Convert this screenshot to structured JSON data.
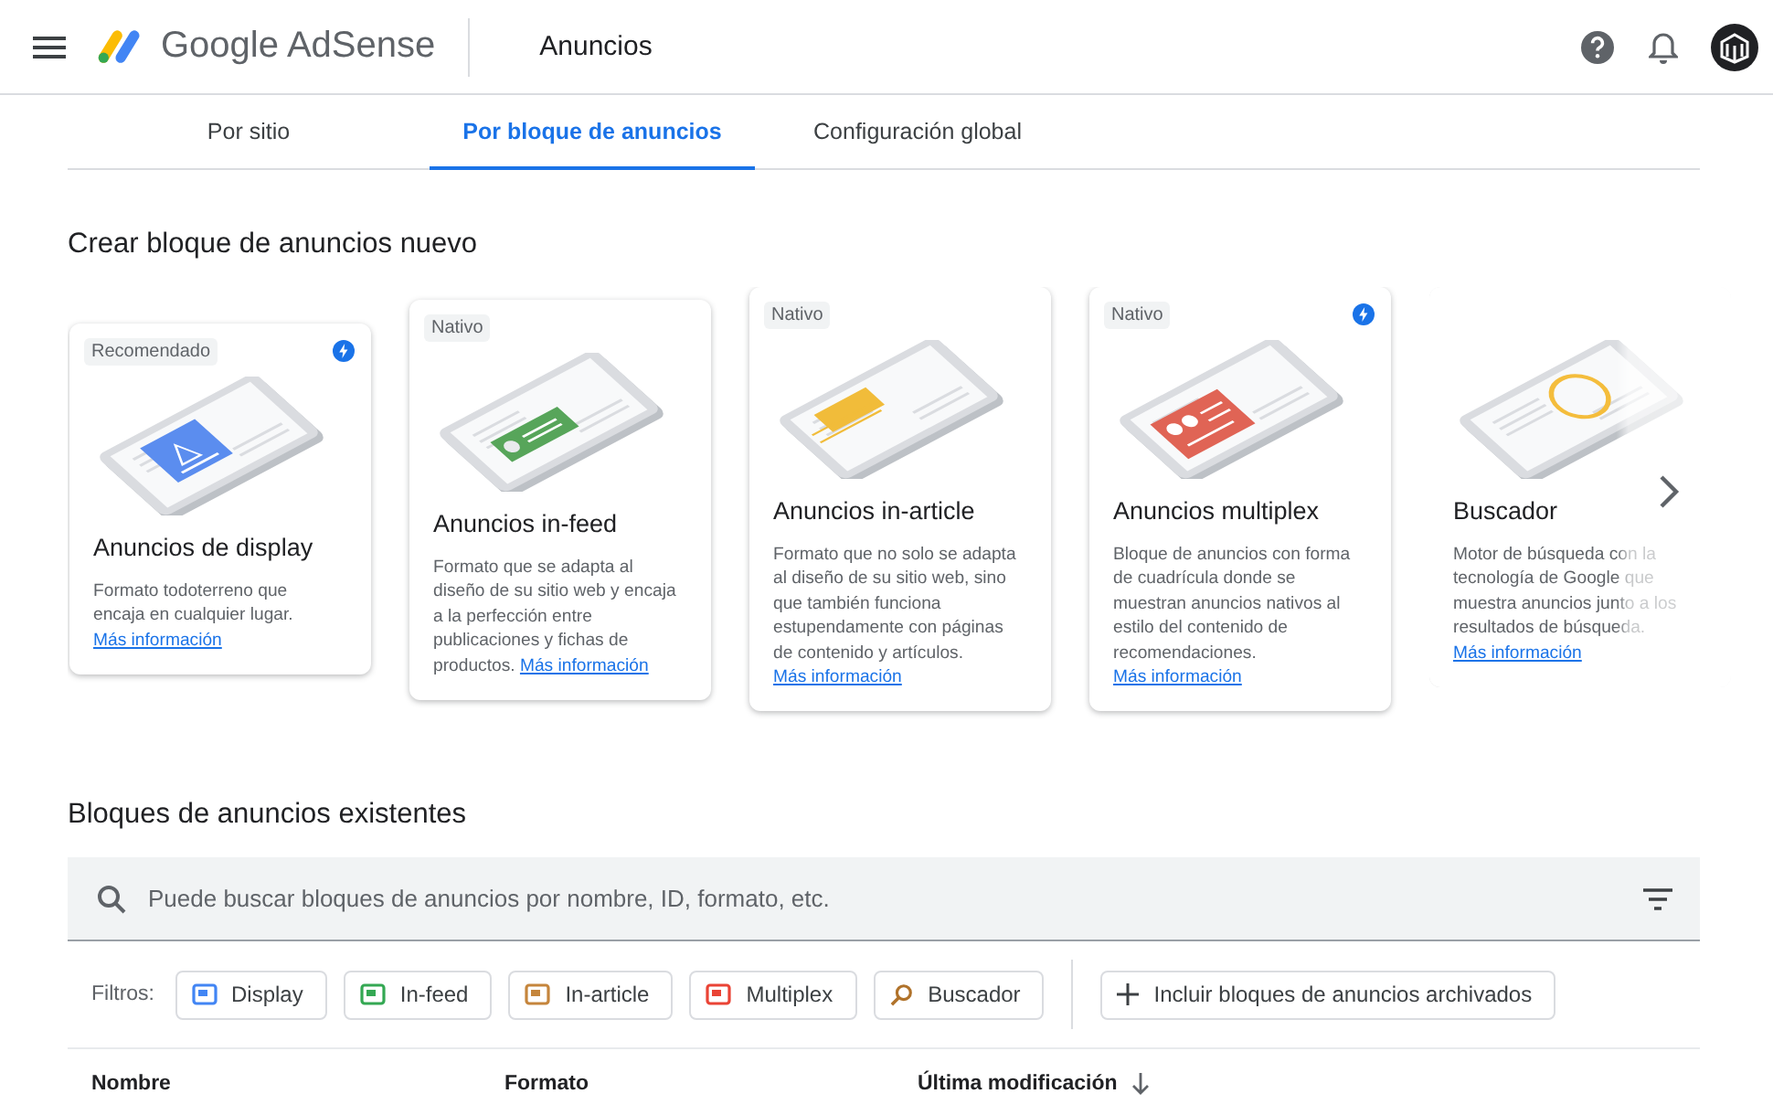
{
  "header": {
    "product": "Google AdSense",
    "page_title": "Anuncios"
  },
  "tabs": [
    {
      "label": "Por sitio",
      "selected": false
    },
    {
      "label": "Por bloque de anuncios",
      "selected": true
    },
    {
      "label": "Configuración global",
      "selected": false
    }
  ],
  "create_section": {
    "title": "Crear bloque de anuncios nuevo",
    "cards": [
      {
        "kind": "display",
        "badge": "Recomendado",
        "boosted": true,
        "color": "#5b8def",
        "title": "Anuncios de display",
        "description": "Formato todoterreno que encaja en cualquier lugar.",
        "link": "Más información"
      },
      {
        "kind": "infeed",
        "badge": "Nativo",
        "boosted": false,
        "color": "#57a55a",
        "title": "Anuncios in-feed",
        "description": "Formato que se adapta al diseño de su sitio web y encaja a la perfección entre publicaciones y fichas de productos.",
        "link": "Más información"
      },
      {
        "kind": "inarticle",
        "badge": "Nativo",
        "boosted": false,
        "color": "#f1bc3a",
        "title": "Anuncios in-article",
        "description": "Formato que no solo se adapta al diseño de su sitio web, sino que también funciona estupendamente con páginas de contenido y artículos.",
        "link": "Más información"
      },
      {
        "kind": "multiplex",
        "badge": "Nativo",
        "boosted": true,
        "color": "#e06455",
        "title": "Anuncios multiplex",
        "description": "Bloque de anuncios con forma de cuadrícula donde se muestran anuncios nativos al estilo del contenido de recomendaciones.",
        "link": "Más información"
      },
      {
        "kind": "search",
        "boosted": false,
        "color": "#f4bd3c",
        "title": "Buscador",
        "description": "Motor de búsqueda con la tecnología de Google que muestra anuncios junto a los resultados de búsqueda.",
        "link": "Más información"
      }
    ]
  },
  "existing_section": {
    "title": "Bloques de anuncios existentes",
    "search": {
      "placeholder": "Puede buscar bloques de anuncios por nombre, ID, formato, etc."
    },
    "filters_label": "Filtros:",
    "filters": [
      {
        "kind": "format",
        "label": "Display",
        "color": "#4285f4"
      },
      {
        "kind": "format",
        "label": "In-feed",
        "color": "#34a853"
      },
      {
        "kind": "format",
        "label": "In-article",
        "color": "#c5853c"
      },
      {
        "kind": "format",
        "label": "Multiplex",
        "color": "#ea4335"
      },
      {
        "kind": "search",
        "label": "Buscador",
        "color": "#b0722a"
      }
    ],
    "archived_button": "Incluir bloques de anuncios archivados",
    "columns": [
      {
        "label": "Nombre",
        "sorted": false
      },
      {
        "label": "Formato",
        "sorted": false
      },
      {
        "label": "Última modificación",
        "sorted": true
      }
    ]
  }
}
